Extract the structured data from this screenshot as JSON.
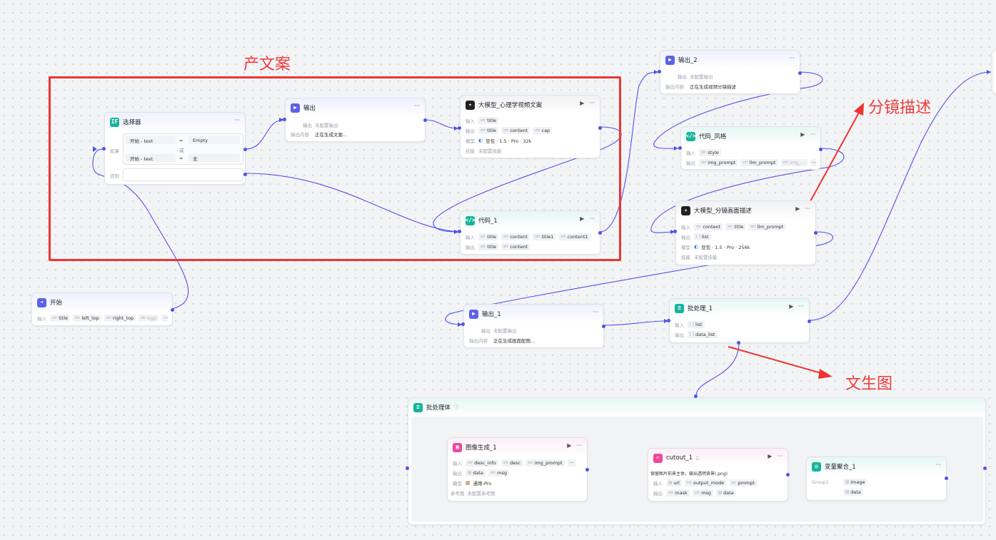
{
  "annotations": {
    "copywriting": "产文案",
    "shot_desc": "分镜描述",
    "text_to_image": "文生图"
  },
  "labels": {
    "input": "输入",
    "output": "输出",
    "model": "模型",
    "skill": "技能",
    "output_content": "输出内容",
    "condition": "如果",
    "else": "否则",
    "or": "或",
    "eq": "=",
    "not_configured_output": "未配置输出",
    "not_configured_skill": "未配置技能",
    "ref_image": "参考图",
    "not_configured_ref": "未配置参考图"
  },
  "nodes": {
    "start": {
      "title": "开始",
      "inputs": [
        "title",
        "left_top",
        "right_top",
        "bgp"
      ]
    },
    "selector": {
      "title": "选择器",
      "cond1": {
        "left": "开始 - text",
        "op": "=",
        "right": "Empty"
      },
      "cond2": {
        "left": "开始 - text",
        "op": "=",
        "right": "无"
      }
    },
    "output_top": {
      "title": "输出",
      "output_content": "正在生成文案..."
    },
    "llm_psych": {
      "title": "大模型_心理学视频文案",
      "inputs": [
        "title"
      ],
      "outputs": [
        "title",
        "content",
        "cap"
      ],
      "model": "豆包 · 1.5 · Pro · 32k"
    },
    "code1": {
      "title": "代码_1",
      "inputs": [
        "title",
        "content",
        "title1",
        "content1"
      ],
      "outputs": [
        "title",
        "content"
      ]
    },
    "output2": {
      "title": "输出_2",
      "output_content": "正在生成视频分镜描述"
    },
    "code_style": {
      "title": "代码_风格",
      "inputs": [
        "style"
      ],
      "outputs": [
        "img_prompt",
        "llm_prompt",
        "img_..."
      ]
    },
    "llm_shot": {
      "title": "大模型_分镜画面描述",
      "inputs": [
        "content",
        "title",
        "llm_prompt"
      ],
      "outputs": [
        "list"
      ],
      "model": "豆包 · 1.5 · Pro · 256k"
    },
    "output1": {
      "title": "输出_1",
      "output_content": "正在生成画面配图..."
    },
    "batch1": {
      "title": "批处理_1",
      "inputs": [
        "list"
      ],
      "outputs": [
        "data_list"
      ]
    },
    "batch_body": {
      "title": "批处理体"
    },
    "imggen": {
      "title": "图像生成_1",
      "inputs": [
        "desc_info",
        "desc",
        "img_prompt"
      ],
      "outputs": [
        "data",
        "msg"
      ],
      "model": "通用-Pro"
    },
    "cutout": {
      "title": "cutout_1",
      "desc": "保留图片前景主体，输出透明背景(.png)",
      "inputs": [
        "url",
        "output_mode",
        "prompt"
      ],
      "outputs": [
        "mask",
        "msg",
        "data"
      ]
    },
    "agg": {
      "title": "变量聚合_1",
      "group": "Group1",
      "items": [
        "image",
        "data"
      ]
    }
  },
  "colors": {
    "accent": "#4d53e8",
    "annotation": "#ef3333",
    "teal": "#14b39a"
  }
}
